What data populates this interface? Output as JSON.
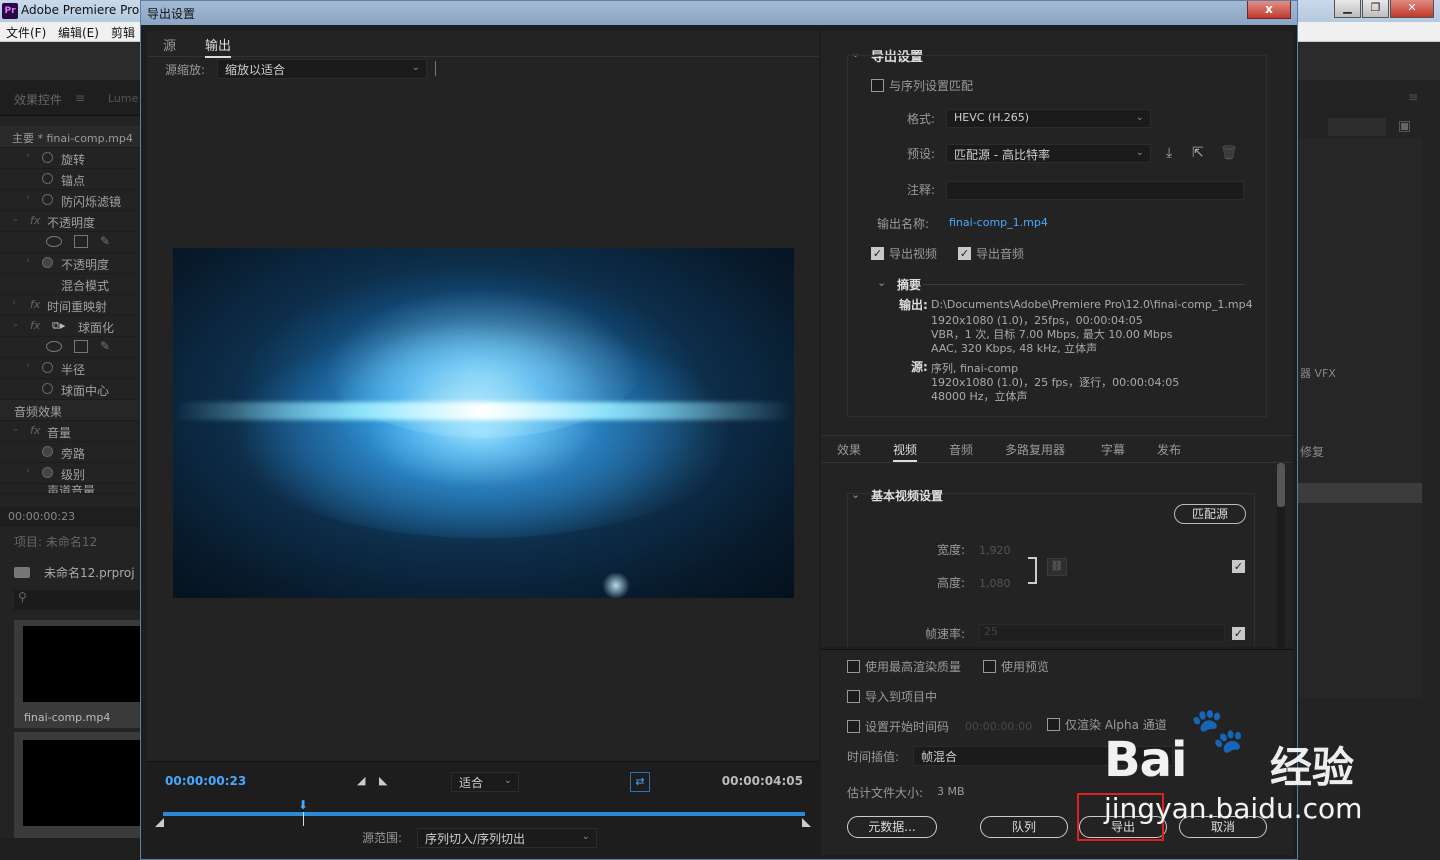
{
  "app": {
    "title": "Adobe Premiere Pro",
    "menu": [
      "文件(F)",
      "编辑(E)",
      "剪辑"
    ],
    "logo": "Pr"
  },
  "left_panel": {
    "tab_effect_controls": "效果控件",
    "tab_lumetri": "Lume",
    "master_label": "主要 * finai-comp.mp4",
    "rows": [
      "旋转",
      "锚点",
      "防闪烁滤镜",
      "不透明度",
      "不透明度",
      "混合模式",
      "时间重映射",
      "球面化",
      "半径",
      "球面中心"
    ],
    "audio_section": "音频效果",
    "audio_rows": [
      "音量",
      "旁路",
      "级别",
      "声道音量"
    ],
    "timecode": "00:00:00:23",
    "project_title": "项目: 未命名12",
    "project_file": "未命名12.prproj",
    "clip_name": "finai-comp.mp4"
  },
  "right_bg": {
    "vfx_label": "器 VFX",
    "repair_label": "修复"
  },
  "dialog": {
    "title": "导出设置",
    "close_glyph": "x",
    "source_tab": "源",
    "output_tab": "输出",
    "source_scale_label": "源缩放:",
    "source_scale_value": "缩放以适合",
    "timecode_current": "00:00:00:23",
    "timecode_end": "00:00:04:05",
    "fit_value": "适合",
    "range_label": "源范围:",
    "range_value": "序列切入/序列切出",
    "export_settings": {
      "header": "导出设置",
      "match_sequence": "与序列设置匹配",
      "format_label": "格式:",
      "format_value": "HEVC (H.265)",
      "preset_label": "预设:",
      "preset_value": "匹配源 - 高比特率",
      "comments_label": "注释:",
      "output_name_label": "输出名称:",
      "output_name_value": "finai-comp_1.mp4",
      "export_video": "导出视频",
      "export_audio": "导出音频",
      "summary_header": "摘要",
      "output_label": "输出:",
      "output_lines": [
        "D:\\Documents\\Adobe\\Premiere Pro\\12.0\\finai-comp_1.mp4",
        "1920x1080 (1.0)，25fps，00:00:04:05",
        "VBR，1 次, 目标 7.00 Mbps, 最大 10.00 Mbps",
        "AAC, 320 Kbps, 48 kHz, 立体声"
      ],
      "source_label": "源:",
      "source_lines": [
        "序列, finai-comp",
        "1920x1080 (1.0)，25 fps，逐行，00:00:04:05",
        "48000 Hz，立体声"
      ]
    },
    "sub_tabs": [
      "效果",
      "视频",
      "音频",
      "多路复用器",
      "字幕",
      "发布"
    ],
    "basic_video": {
      "header": "基本视频设置",
      "match_source_btn": "匹配源",
      "width_label": "宽度:",
      "width_value": "1,920",
      "height_label": "高度:",
      "height_value": "1,080",
      "framerate_label": "帧速率:",
      "framerate_value": "25"
    },
    "bottom": {
      "max_render_quality": "使用最高渲染质量",
      "use_previews": "使用预览",
      "import_into_project": "导入到项目中",
      "set_start_timecode": "设置开始时间码",
      "start_timecode_value": "00:00:00:00",
      "render_alpha_only": "仅渲染 Alpha 通道",
      "time_interpolation_label": "时间插值:",
      "time_interpolation_value": "帧混合",
      "file_size_label": "估计文件大小:",
      "file_size_value": "3 MB",
      "metadata_btn": "元数据...",
      "queue_btn": "队列",
      "export_btn": "导出",
      "cancel_btn": "取消"
    }
  },
  "watermark": {
    "brand": "Bai",
    "brand_cn": "经验",
    "url": "jingyan.baidu.com"
  },
  "colors": {
    "accent_blue": "#4aa8ff",
    "highlight_red": "#e02020"
  }
}
